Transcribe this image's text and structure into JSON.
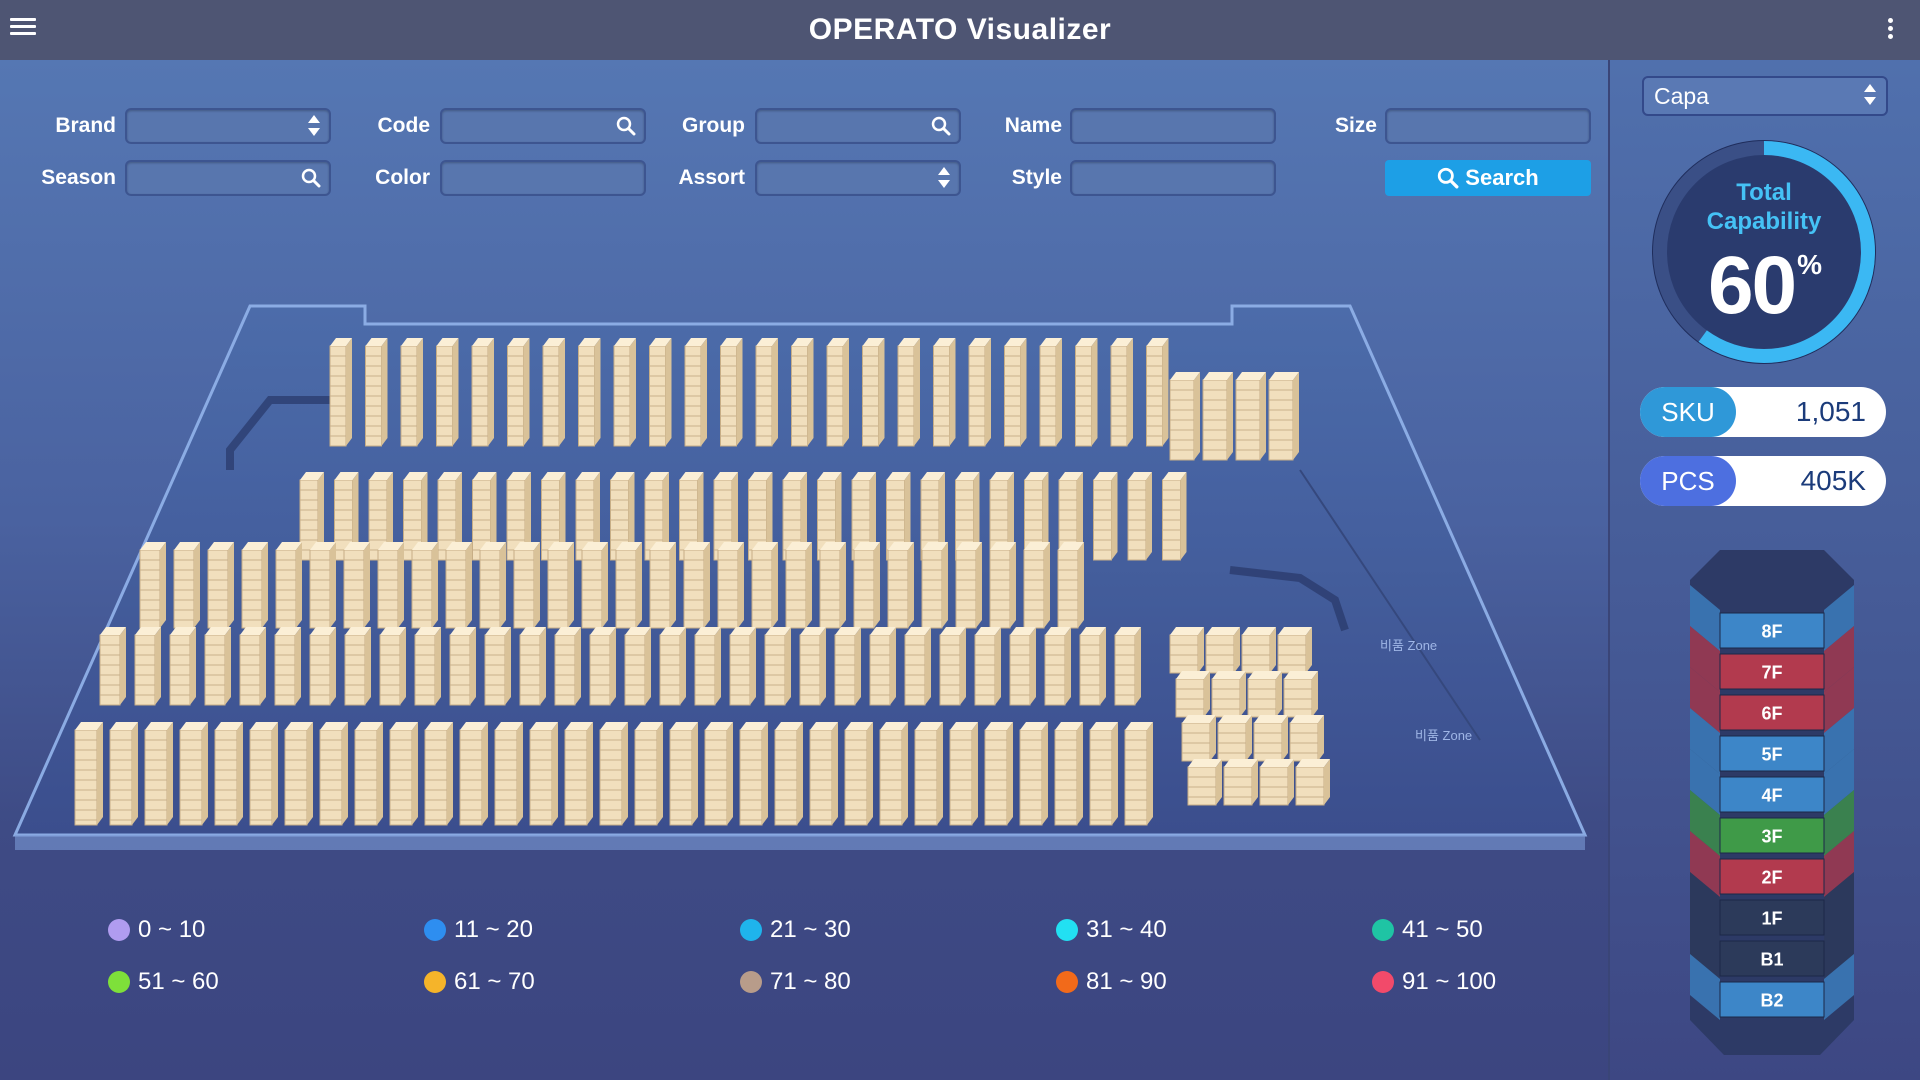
{
  "app": {
    "title": "OPERATO Visualizer"
  },
  "filters": {
    "brand": {
      "label": "Brand",
      "value": ""
    },
    "code": {
      "label": "Code",
      "value": ""
    },
    "group": {
      "label": "Group",
      "value": ""
    },
    "name": {
      "label": "Name",
      "value": ""
    },
    "size": {
      "label": "Size",
      "value": ""
    },
    "season": {
      "label": "Season",
      "value": ""
    },
    "color": {
      "label": "Color",
      "value": ""
    },
    "assort": {
      "label": "Assort",
      "value": ""
    },
    "style": {
      "label": "Style",
      "value": ""
    },
    "search_button": "Search"
  },
  "map": {
    "zone_labels": [
      "비품 Zone",
      "비품 Zone"
    ]
  },
  "legend": [
    {
      "label": "0 ~ 10",
      "color": "#b09cf0"
    },
    {
      "label": "11 ~ 20",
      "color": "#2e8ef0"
    },
    {
      "label": "21 ~ 30",
      "color": "#1fb4ec"
    },
    {
      "label": "31 ~ 40",
      "color": "#22e0f2"
    },
    {
      "label": "41 ~ 50",
      "color": "#1fc4a4"
    },
    {
      "label": "51 ~ 60",
      "color": "#7ee03a"
    },
    {
      "label": "61 ~ 70",
      "color": "#f5b42a"
    },
    {
      "label": "71 ~ 80",
      "color": "#b89c8a"
    },
    {
      "label": "81 ~ 90",
      "color": "#f26a1a"
    },
    {
      "label": "91 ~ 100",
      "color": "#f24a6a"
    }
  ],
  "side": {
    "select": {
      "value": "Capa"
    },
    "gauge": {
      "label_line1": "Total",
      "label_line2": "Capability",
      "value": "60",
      "unit": "%",
      "fraction": 0.6
    },
    "sku": {
      "label": "SKU",
      "value": "1,051"
    },
    "pcs": {
      "label": "PCS",
      "value": "405K"
    },
    "floors": [
      {
        "label": "8F",
        "color": "#3d86c8"
      },
      {
        "label": "7F",
        "color": "#b23a4e"
      },
      {
        "label": "6F",
        "color": "#b23a4e"
      },
      {
        "label": "5F",
        "color": "#3d86c8"
      },
      {
        "label": "4F",
        "color": "#3d86c8"
      },
      {
        "label": "3F",
        "color": "#3f9a48"
      },
      {
        "label": "2F",
        "color": "#b23a4e"
      },
      {
        "label": "1F",
        "color": "#2c3a5a"
      },
      {
        "label": "B1",
        "color": "#2c3a5a"
      },
      {
        "label": "B2",
        "color": "#3d86c8"
      }
    ]
  }
}
